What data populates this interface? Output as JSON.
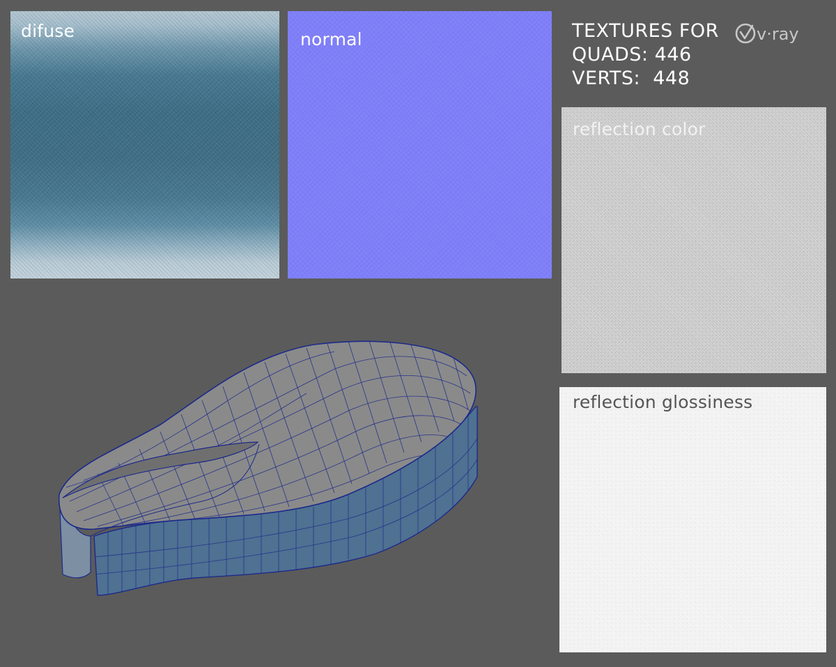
{
  "textures": {
    "diffuse": {
      "label": "difuse"
    },
    "normal": {
      "label": "normal"
    },
    "reflection_color": {
      "label": "reflection color"
    },
    "reflection_glossiness": {
      "label": "reflection glossiness"
    }
  },
  "info": {
    "title": "TEXTURES FOR",
    "quads": "QUADS: 446",
    "verts": "VERTS:  448",
    "brand": "v·ray"
  },
  "colors": {
    "background": "#5b5b5b",
    "normal_map": "#7f7ff9",
    "wireframe": "#1c2a8a",
    "mesh_top": "#878787",
    "mesh_side": "#4e6e8e"
  },
  "mesh_preview": {
    "icon": "wireframe-mesh-render"
  }
}
